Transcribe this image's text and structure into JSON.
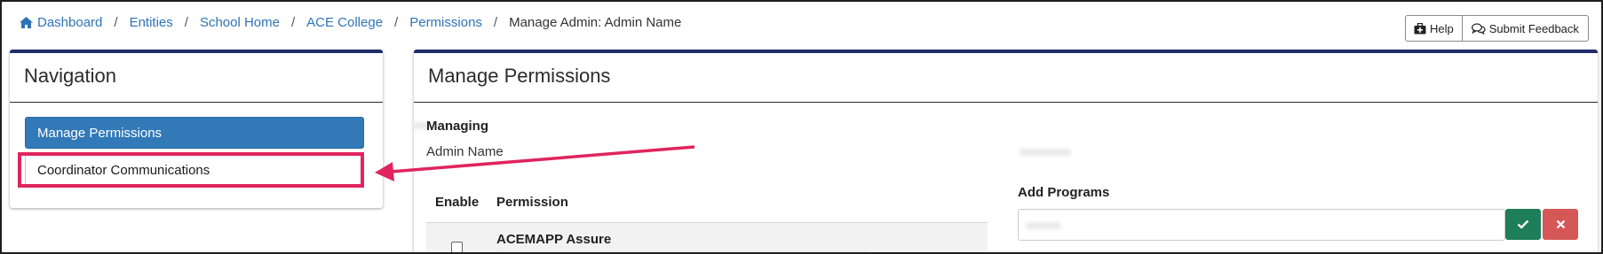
{
  "breadcrumb": {
    "items": [
      "Dashboard",
      "Entities",
      "School Home",
      "ACE College",
      "Permissions"
    ],
    "separator": "/",
    "current": "Manage Admin: Admin Name"
  },
  "top_buttons": {
    "help": "Help",
    "feedback": "Submit Feedback"
  },
  "nav_panel": {
    "title": "Navigation",
    "items": [
      "Manage Permissions",
      "Coordinator Communications"
    ]
  },
  "main_panel": {
    "title": "Manage Permissions",
    "managing_label": "Managing",
    "admin_name": "Admin Name",
    "table": {
      "headers": [
        "Enable",
        "Permission"
      ],
      "rows": [
        {
          "title": "ACEMAPP Assure"
        }
      ]
    },
    "add_programs_label": "Add Programs"
  },
  "colors": {
    "panel_border": "#1f2d6b",
    "primary": "#3279b7",
    "link": "#2f73b6",
    "highlight": "#e0245e",
    "ok": "#1e7d5b",
    "cancel": "#d65757"
  },
  "icons": {
    "breadcrumb": "home-icon",
    "help": "medical-kit-icon",
    "feedback": "chat-bubbles-icon",
    "ok": "checkmark-icon",
    "cancel": "close-icon"
  }
}
